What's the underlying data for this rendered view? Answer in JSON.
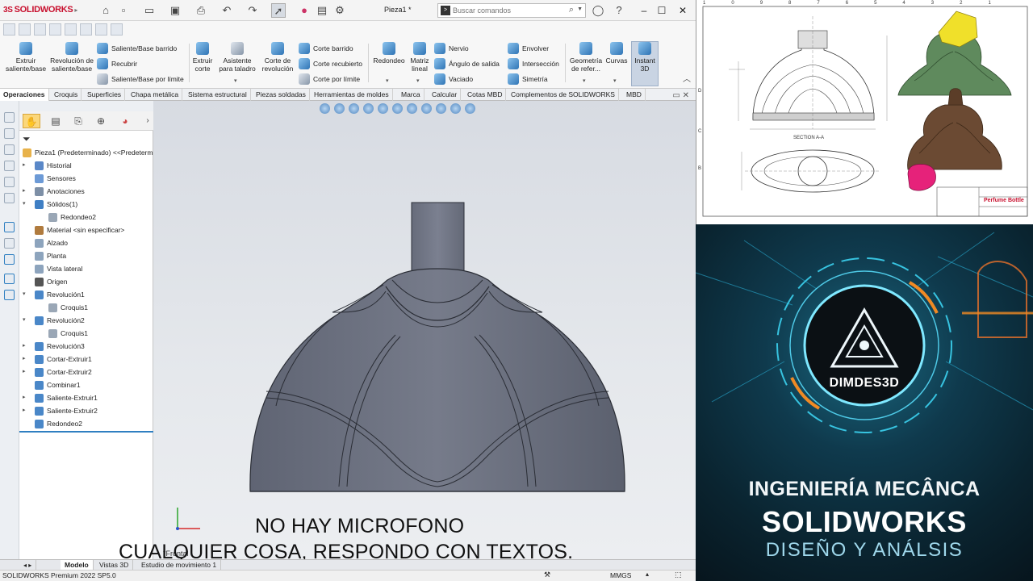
{
  "app": {
    "logo_text": "SOLIDWORKS",
    "document_title": "Pieza1 *",
    "search_placeholder": "Buscar comandos"
  },
  "ribbon": {
    "big": [
      {
        "label": "Extruir saliente/base",
        "icon": "extrude-boss-icon"
      },
      {
        "label": "Revolución de saliente/base",
        "icon": "revolve-boss-icon"
      },
      {
        "label": "Extruir corte",
        "icon": "extrude-cut-icon"
      },
      {
        "label": "Asistente para taladro",
        "icon": "hole-wizard-icon"
      },
      {
        "label": "Corte de revolución",
        "icon": "revolve-cut-icon"
      },
      {
        "label": "Redondeo",
        "icon": "fillet-icon"
      },
      {
        "label": "Matriz lineal",
        "icon": "linear-pattern-icon"
      },
      {
        "label": "Geometría de refer...",
        "icon": "reference-geometry-icon"
      },
      {
        "label": "Curvas",
        "icon": "curves-icon"
      },
      {
        "label": "Instant 3D",
        "icon": "instant3d-icon"
      }
    ],
    "small": [
      {
        "label": "Saliente/Base barrido",
        "icon": "swept-boss-icon"
      },
      {
        "label": "Recubrir",
        "icon": "loft-icon"
      },
      {
        "label": "Saliente/Base por límite",
        "icon": "boundary-boss-icon"
      },
      {
        "label": "Corte barrido",
        "icon": "swept-cut-icon"
      },
      {
        "label": "Corte recubierto",
        "icon": "lofted-cut-icon"
      },
      {
        "label": "Corte por límite",
        "icon": "boundary-cut-icon"
      },
      {
        "label": "Nervio",
        "icon": "rib-icon"
      },
      {
        "label": "Ángulo de salida",
        "icon": "draft-icon"
      },
      {
        "label": "Vaciado",
        "icon": "shell-icon"
      },
      {
        "label": "Envolver",
        "icon": "wrap-icon"
      },
      {
        "label": "Intersección",
        "icon": "intersect-icon"
      },
      {
        "label": "Simetría",
        "icon": "mirror-icon"
      }
    ]
  },
  "command_tabs": [
    "Operaciones",
    "Croquis",
    "Superficies",
    "Chapa metálica",
    "Sistema estructural",
    "Piezas soldadas",
    "Herramientas de moldes",
    "Marca",
    "Calcular",
    "Cotas MBD",
    "Complementos de SOLIDWORKS",
    "MBD"
  ],
  "feature_tree": {
    "root": "Pieza1 (Predeterminado) <<Predeterm",
    "items": [
      {
        "label": "Historial",
        "level": 1,
        "arrow": true
      },
      {
        "label": "Sensores",
        "level": 1,
        "arrow": false
      },
      {
        "label": "Anotaciones",
        "level": 1,
        "arrow": true
      },
      {
        "label": "Sólidos(1)",
        "level": 1,
        "arrow": true,
        "expanded": true
      },
      {
        "label": "Redondeo2",
        "level": 2,
        "arrow": false
      },
      {
        "label": "Material <sin especificar>",
        "level": 1,
        "arrow": false
      },
      {
        "label": "Alzado",
        "level": 1,
        "arrow": false
      },
      {
        "label": "Planta",
        "level": 1,
        "arrow": false
      },
      {
        "label": "Vista lateral",
        "level": 1,
        "arrow": false
      },
      {
        "label": "Origen",
        "level": 1,
        "arrow": false
      },
      {
        "label": "Revolución1",
        "level": 1,
        "arrow": true,
        "expanded": true
      },
      {
        "label": "Croquis1",
        "level": 2,
        "arrow": false
      },
      {
        "label": "Revolución2",
        "level": 1,
        "arrow": true,
        "expanded": true
      },
      {
        "label": "Croquis1",
        "level": 2,
        "arrow": false
      },
      {
        "label": "Revolución3",
        "level": 1,
        "arrow": true
      },
      {
        "label": "Cortar-Extruir1",
        "level": 1,
        "arrow": true
      },
      {
        "label": "Cortar-Extruir2",
        "level": 1,
        "arrow": true
      },
      {
        "label": "Combinar1",
        "level": 1,
        "arrow": false
      },
      {
        "label": "Saliente-Extruir1",
        "level": 1,
        "arrow": true
      },
      {
        "label": "Saliente-Extruir2",
        "level": 1,
        "arrow": true
      },
      {
        "label": "Redondeo2",
        "level": 1,
        "arrow": false
      }
    ]
  },
  "viewport": {
    "view_label": "*Frontal",
    "subtitle_line1": "NO HAY MICROFONO",
    "subtitle_line2": "CUALQUIER COSA, RESPONDO CON TEXTOS."
  },
  "bottom_tabs": [
    "Modelo",
    "Vistas 3D",
    "Estudio de movimiento 1"
  ],
  "status": {
    "left": "SOLIDWORKS Premium 2022 SP5.0",
    "units": "MMGS"
  },
  "drawing": {
    "title_block": "Perfume Bottle",
    "section_label": "SECTION A-A",
    "border_numbers_top": [
      "10",
      "9",
      "8",
      "7",
      "6",
      "5",
      "4",
      "3",
      "2",
      "1"
    ],
    "border_letters": [
      "D",
      "C",
      "B"
    ]
  },
  "promo": {
    "brand": "DIMDES3D",
    "title_line1": "INGENIERÍA MECÂNCA",
    "title_line2": "SOLIDWORKS",
    "title_line3": "DISEÑO Y ANÁLSIS"
  },
  "colors": {
    "model_fill": "#6f7483",
    "accent_blue": "#2f7fc1",
    "brand_red": "#c8102e",
    "promo_teal": "#1a6a82",
    "promo_orange": "#f08a24"
  }
}
